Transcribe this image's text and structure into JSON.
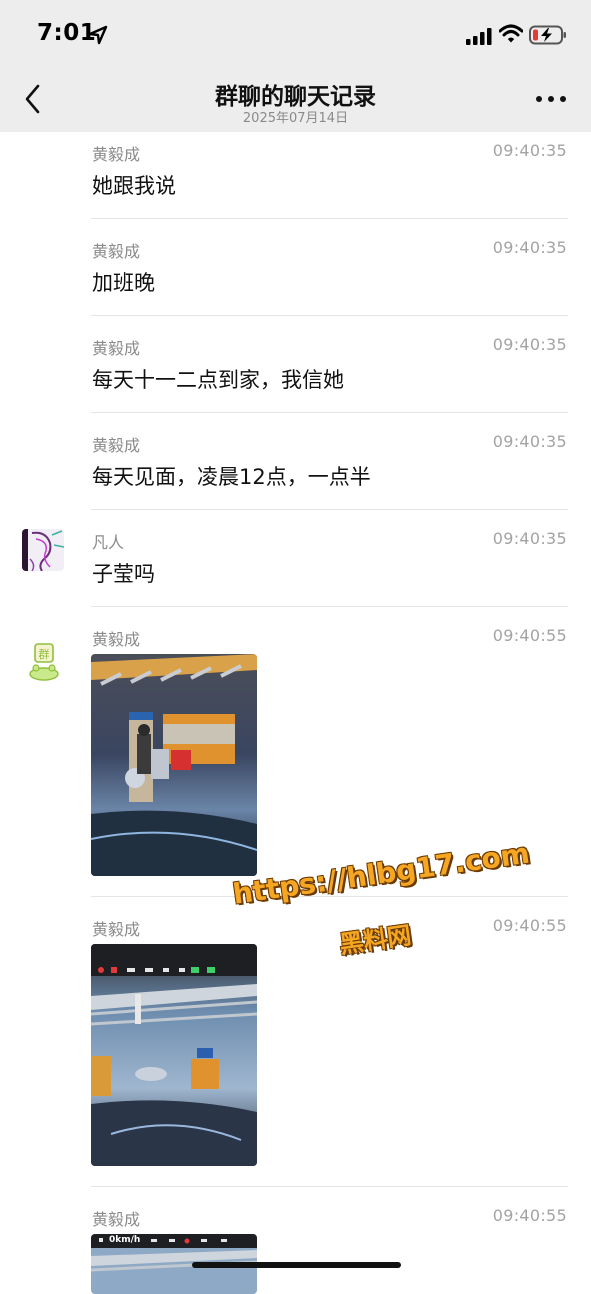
{
  "status_bar": {
    "time": "7:01",
    "battery_color": "#e53935"
  },
  "nav": {
    "title": "群聊的聊天记录",
    "subtitle": "2025年07月14日"
  },
  "messages": [
    {
      "sender": "黄毅成",
      "time": "09:40:35",
      "text": "她跟我说"
    },
    {
      "sender": "黄毅成",
      "time": "09:40:35",
      "text": "加班晚"
    },
    {
      "sender": "黄毅成",
      "time": "09:40:35",
      "text": "每天十一二点到家，我信她"
    },
    {
      "sender": "黄毅成",
      "time": "09:40:35",
      "text": "每天见面，凌晨12点，一点半"
    },
    {
      "sender": "凡人",
      "time": "09:40:35",
      "text": "子莹吗"
    },
    {
      "sender": "黄毅成",
      "time": "09:40:55",
      "image": "parking-garage-scooter-photo"
    },
    {
      "sender": "黄毅成",
      "time": "09:40:55",
      "image": "dashcam-parking-garage-photo"
    },
    {
      "sender": "黄毅成",
      "time": "09:40:55",
      "image": "dashcam-photo",
      "overlay_text": "0km/h"
    }
  ],
  "avatar_badge": "群",
  "watermark": {
    "url": "https://hlbg17.com",
    "label": "黑料网"
  },
  "colors": {
    "header_bg": "#ededed",
    "watermark": "#f5a623"
  }
}
